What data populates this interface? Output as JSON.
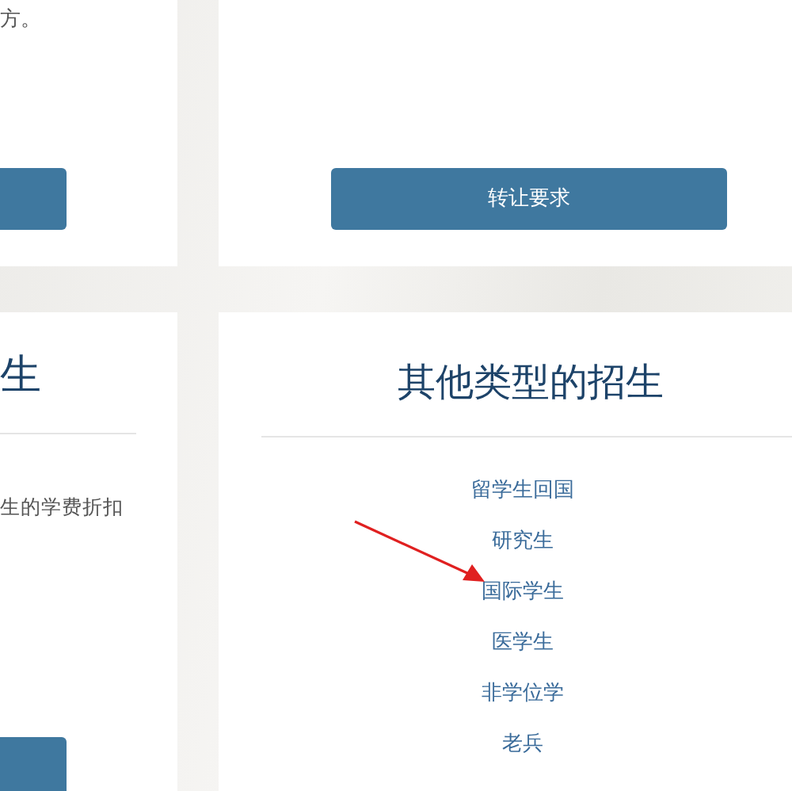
{
  "top_left_card": {
    "text": "方。",
    "has_button": true
  },
  "top_right_card": {
    "button": "转让要求"
  },
  "bottom_left_card": {
    "title": "生",
    "text": "生的学费折扣",
    "has_button": true
  },
  "bottom_right_card": {
    "title": "其他类型的招生",
    "links": [
      "留学生回国",
      "研究生",
      "国际学生",
      "医学生",
      "非学位学",
      "老兵"
    ]
  }
}
